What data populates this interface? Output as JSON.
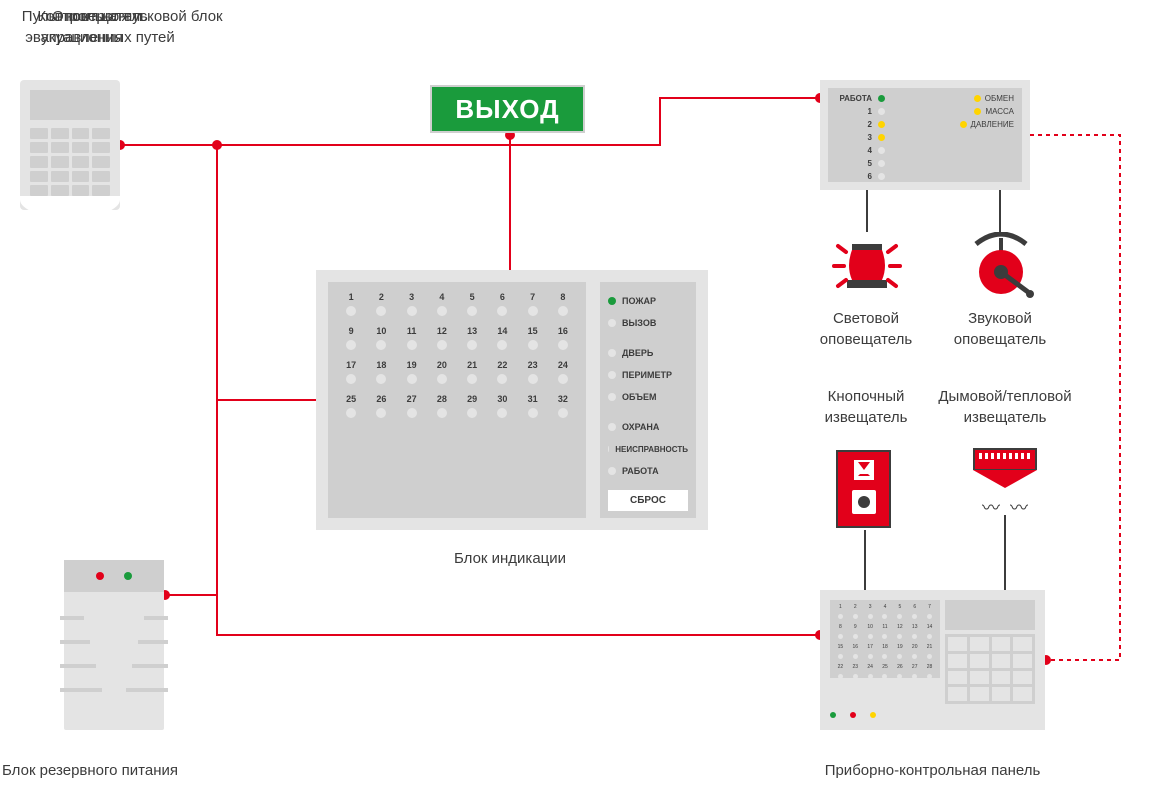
{
  "labels": {
    "keypad": "Пульт контроля и управления",
    "exit_header": "Оповещатель эвакуационных путей",
    "exit_text": "ВЫХОД",
    "clb": "Контрольно-пусковой блок",
    "ups": "Блок резервного питания",
    "ib": "Блок индикации",
    "light_alarm": "Световой оповещатель",
    "sound_alarm": "Звуковой оповещатель",
    "callpoint": "Кнопочный извещатель",
    "smoke": "Дымовой/тепловой извещатель",
    "cpanel": "Приборно-контрольная панель"
  },
  "clb": {
    "left_label": "РАБОТА",
    "right": [
      "ОБМЕН",
      "МАССА",
      "ДАВЛЕНИЕ"
    ],
    "nums": [
      "1",
      "2",
      "3",
      "4",
      "5",
      "6"
    ]
  },
  "indicator_block": {
    "zones": [
      "1",
      "2",
      "3",
      "4",
      "5",
      "6",
      "7",
      "8",
      "9",
      "10",
      "11",
      "12",
      "13",
      "14",
      "15",
      "16",
      "17",
      "18",
      "19",
      "20",
      "21",
      "22",
      "23",
      "24",
      "25",
      "26",
      "27",
      "28",
      "29",
      "30",
      "31",
      "32"
    ],
    "statuses": [
      "ПОЖАР",
      "ВЫЗОВ",
      "ДВЕРЬ",
      "ПЕРИМЕТР",
      "ОБЪЕМ",
      "ОХРАНА",
      "НЕИСПРАВНОСТЬ",
      "РАБОТА"
    ],
    "reset": "СБРОС"
  },
  "colors": {
    "red": "#e2001a",
    "green": "#1a9b3c",
    "yellow": "#ffd400",
    "panel": "#e4e4e4",
    "panel_dark": "#cfcfcf"
  }
}
